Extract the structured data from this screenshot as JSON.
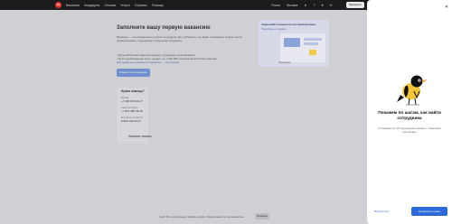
{
  "topbar": {
    "logo_text": "hh",
    "nav": [
      "Вакансии",
      "Кандидаты",
      "Отклики",
      "Услуги",
      "Сервисы",
      "Помощь"
    ],
    "right_items": [
      "Поиск",
      "Москва",
      "★",
      "?",
      "♥",
      "✉"
    ],
    "vacancy_button": "Вакансия"
  },
  "main": {
    "title": "Заполните вашу первую вакансию",
    "intro": "Вакансия — это объявление о поиске сотрудника. Вы публикуете, его видят и выбирают в своих ленте профессионалы, подходящие к будущему сотруднику.",
    "bullets": [
      "Более 60% работодателей находят сотрудника через вакансии",
      "За 15 дней вакансию могут увидеть до 7 000 000 соискателей в России и Москве"
    ],
    "link_text": "Как правильно разместить вакансию — инструкция",
    "post_button": "Разместить вакансию"
  },
  "promo": {
    "title": "Закрывайте вакансии оптимизировано",
    "link": "Подробнее о сервисе",
    "caption": "Подробнее"
  },
  "help": {
    "title": "Нужна помощь?",
    "contacts": [
      {
        "label": "Москва",
        "phone": "+7 495 974-64-27"
      },
      {
        "label": "Санкт-Петербург",
        "phone": "+7 812 458-45-45"
      },
      {
        "label": "Бесплатно по России",
        "phone": "8 800 100-64-27"
      }
    ],
    "write_link": "Написать письмо"
  },
  "cookie": {
    "text": "Сайт hh.ru использует файлы cookie. Продолжая, вы соглашаетесь",
    "button": "Понятно"
  },
  "panel": {
    "close": "✕",
    "title": "Покажем по шагам, как найти сотрудника",
    "subtitle": "И поможем до 15 подходящих резюме с открытыми контактами",
    "skip_button": "Пропустить",
    "start_button": "Посмотреть шаги"
  }
}
